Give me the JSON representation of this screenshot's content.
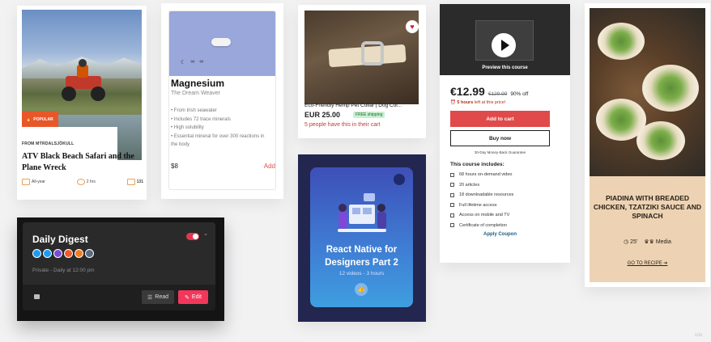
{
  "atv": {
    "badge": "POPULAR",
    "from": "FROM MÝRDALSJÖKULL",
    "title": "ATV Black Beach Safari and the Plane Wreck",
    "season": "All-year",
    "duration": "2 hrs",
    "count": "131"
  },
  "magnesium": {
    "name": "Magnesium",
    "subtitle": "The Dream Weaver",
    "features": [
      "From Irish seawater",
      "Includes 72 trace minerals",
      "High solubility",
      "Essential mineral for over 300 reactions in the body"
    ],
    "price": "$8",
    "add_label": "Add"
  },
  "collar": {
    "title": "Eco-Friendly Hemp Pet Collar | Dog Col...",
    "price": "EUR 25.00",
    "shipping": "FREE shipping",
    "cart_note": "5 people have this in their cart"
  },
  "react_course": {
    "title": "React Native for Designers Part 2",
    "sub": "12 videos - 3 hours"
  },
  "course": {
    "preview": "Preview this course",
    "price": "€12.99",
    "original": "€129.99",
    "discount": "90% off",
    "time_left_bold": "5 hours",
    "time_left_rest": " left at this price!",
    "add_to_cart": "Add to cart",
    "buy_now": "Buy now",
    "guarantee": "30-Day Money-Back Guarantee",
    "includes_title": "This course includes:",
    "includes": [
      "68 hours on-demand video",
      "20 articles",
      "18 downloadable resources",
      "Full lifetime access",
      "Access on mobile and TV",
      "Certificate of completion"
    ],
    "coupon": "Apply Coupon"
  },
  "recipe": {
    "title": "PIADINA WITH BREADED CHICKEN, TZATZIKI SAUCE AND SPINACH",
    "time": "25'",
    "level": "Media",
    "link": "GO TO RECIPE ➔"
  },
  "digest": {
    "title": "Daily Digest",
    "status": "Private - Daily at 12:00 pm",
    "read_label": "Read",
    "edit_label": "Edit",
    "source_colors": [
      "#1d9bf0",
      "#1d9bf0",
      "#7b4bd8",
      "#f05a28",
      "#f47c20",
      "#5b6b82"
    ]
  },
  "watermark": "lide"
}
